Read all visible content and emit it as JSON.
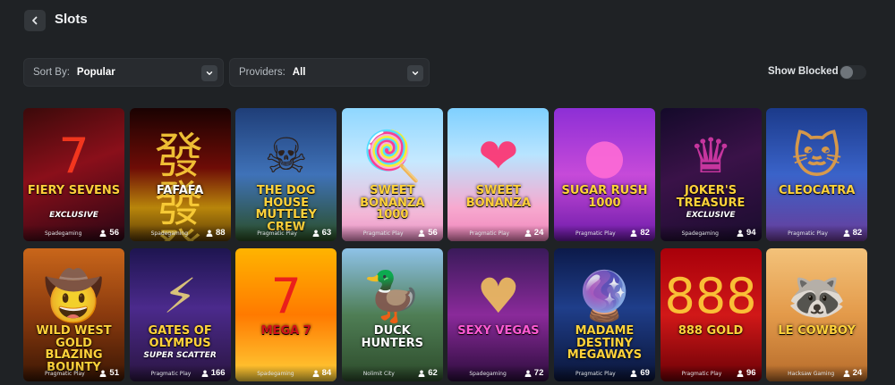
{
  "header": {
    "title": "Slots",
    "back_icon": "chevron-left-icon"
  },
  "filters": {
    "sort": {
      "label": "Sort By:",
      "value": "Popular"
    },
    "providers": {
      "label": "Providers:",
      "value": "All"
    },
    "show_blocked": {
      "label": "Show Blocked",
      "enabled": false
    }
  },
  "colors": {
    "background": "#1f2225",
    "control": "#282b2f"
  },
  "games": [
    {
      "title": "FIERY SEVENS",
      "subtitle": "EXCLUSIVE",
      "provider": "Spadegaming",
      "players": "56",
      "deco": "7",
      "bg": "linear-gradient(160deg,#3b0a0a,#8a0f1a 45%,#2a0614)",
      "title_color": "#ffcf3a",
      "deco_color": "#ff3b1f"
    },
    {
      "title": "FAFAFA",
      "subtitle": "",
      "provider": "Spadegaming",
      "players": "88",
      "deco": "發發發",
      "bg": "linear-gradient(180deg,#1a0202,#6e0c06 45%,#b8860b 75%,#5a3a06)",
      "title_color": "#ffffff",
      "deco_color": "#ffd23a"
    },
    {
      "title": "THE DOG HOUSE MUTTLEY CREW",
      "subtitle": "",
      "provider": "Pragmatic Play",
      "players": "63",
      "deco": "☠",
      "bg": "linear-gradient(180deg,#1f3e78,#3f72b8 50%,#2a4d22)",
      "title_color": "#ffd23a",
      "deco_color": "#2b1a0f"
    },
    {
      "title": "SWEET BONANZA 1000",
      "subtitle": "",
      "provider": "Pragmatic Play",
      "players": "56",
      "deco": "🍭",
      "bg": "linear-gradient(180deg,#8fd7ff,#c6e9ff 40%,#f3b6d6 80%,#e98fc4)",
      "title_color": "#ffd23a",
      "deco_color": "#ff5aa0"
    },
    {
      "title": "SWEET BONANZA",
      "subtitle": "",
      "provider": "Pragmatic Play",
      "players": "24",
      "deco": "❤",
      "bg": "linear-gradient(180deg,#7fd0ff,#b8e4ff 35%,#f7a9cf 75%,#ef84ba)",
      "title_color": "#ffcf3a",
      "deco_color": "#ff2f6e"
    },
    {
      "title": "SUGAR RUSH 1000",
      "subtitle": "",
      "provider": "Pragmatic Play",
      "players": "82",
      "deco": "●",
      "bg": "linear-gradient(180deg,#8d2fd6,#c64ad9 50%,#6c1aa8)",
      "title_color": "#ffd23a",
      "deco_color": "#ff6bd6"
    },
    {
      "title": "JOKER'S TREASURE",
      "subtitle": "EXCLUSIVE",
      "provider": "Spadegaming",
      "players": "94",
      "deco": "♛",
      "bg": "linear-gradient(160deg,#140a2a,#3a1248 45%,#1a0c2e)",
      "title_color": "#ffd23a",
      "deco_color": "#d63aa8"
    },
    {
      "title": "CLEOCATRA",
      "subtitle": "",
      "provider": "Pragmatic Play",
      "players": "82",
      "deco": "🐱",
      "bg": "linear-gradient(180deg,#1b3a8a,#3a63c9 50%,#6a3c9a)",
      "title_color": "#ffd23a",
      "deco_color": "#e8a040"
    },
    {
      "title": "WILD WEST GOLD BLAZING BOUNTY",
      "subtitle": "",
      "provider": "Pragmatic Play",
      "players": "51",
      "deco": "🤠",
      "bg": "linear-gradient(180deg,#c9661a,#8a3a0e 50%,#3a1604)",
      "title_color": "#ffd23a",
      "deco_color": "#2a1808"
    },
    {
      "title": "GATES OF OLYMPUS",
      "subtitle": "SUPER SCATTER",
      "provider": "Pragmatic Play",
      "players": "166",
      "deco": "⚡",
      "bg": "linear-gradient(180deg,#1e1550,#4b2a8c 45%,#2a1540)",
      "title_color": "#ffd23a",
      "deco_color": "#e9d27a"
    },
    {
      "title": "MEGA 7",
      "subtitle": "",
      "provider": "Spadegaming",
      "players": "84",
      "deco": "7",
      "bg": "linear-gradient(180deg,#ffb400,#ff7a00 50%,#ffd23a)",
      "title_color": "#d0101a",
      "deco_color": "#e8141f"
    },
    {
      "title": "DUCK HUNTERS",
      "subtitle": "",
      "provider": "Nolimit City",
      "players": "62",
      "deco": "🦆",
      "bg": "linear-gradient(180deg,#8ec2e8,#4f7e55 50%,#2c4a2a)",
      "title_color": "#ffffff",
      "deco_color": "#2c5e2e"
    },
    {
      "title": "SEXY VEGAS",
      "subtitle": "",
      "provider": "Spadegaming",
      "players": "72",
      "deco": "♥",
      "bg": "linear-gradient(180deg,#3a1a5a,#8a2a9a 50%,#2a0c3a)",
      "title_color": "#ff5ad2",
      "deco_color": "#f0c060"
    },
    {
      "title": "MADAME DESTINY MEGAWAYS",
      "subtitle": "",
      "provider": "Pragmatic Play",
      "players": "69",
      "deco": "🔮",
      "bg": "linear-gradient(180deg,#0c1a4a,#1f3e8a 45%,#0a1436)",
      "title_color": "#ffd23a",
      "deco_color": "#b03050"
    },
    {
      "title": "888 GOLD",
      "subtitle": "",
      "provider": "Pragmatic Play",
      "players": "96",
      "deco": "888",
      "bg": "linear-gradient(180deg,#a8000a,#d11818 50%,#6a0006)",
      "title_color": "#ffd23a",
      "deco_color": "#ffd23a"
    },
    {
      "title": "LE COWBOY",
      "subtitle": "",
      "provider": "Hacksaw Gaming",
      "players": "24",
      "deco": "🦝",
      "bg": "linear-gradient(180deg,#f3c27a,#e39a4a 50%,#b56a2a)",
      "title_color": "#ffd23a",
      "deco_color": "#5a5a5a"
    }
  ]
}
